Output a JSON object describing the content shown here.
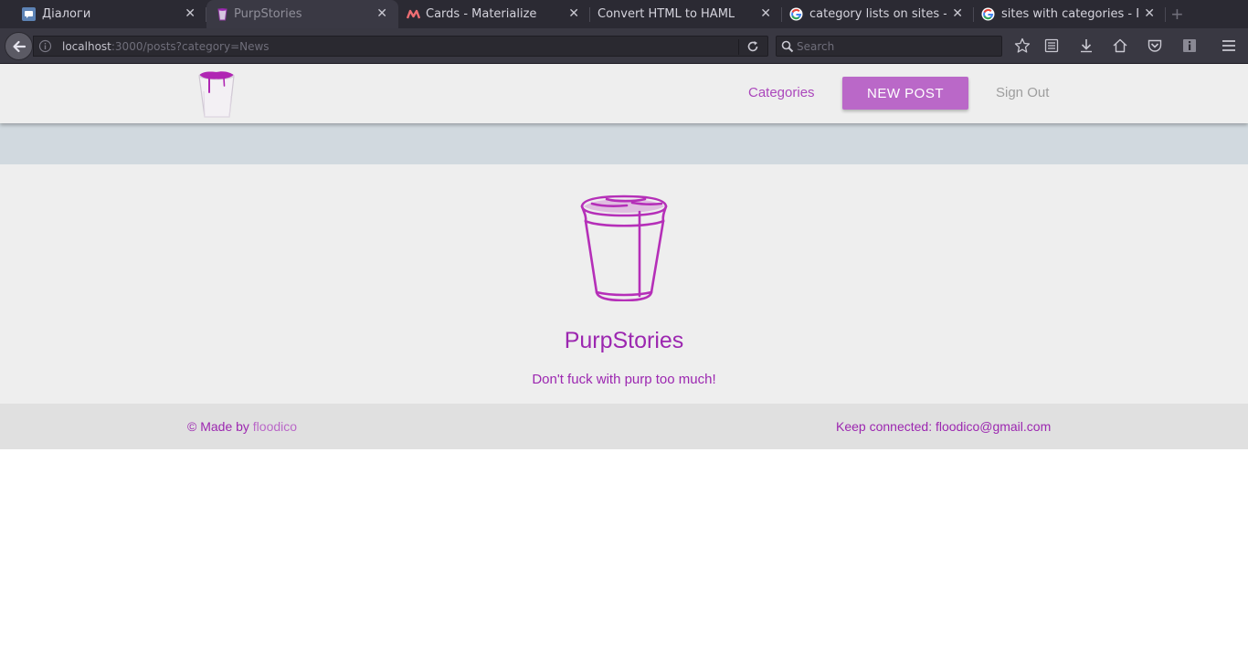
{
  "browser": {
    "tabs": [
      {
        "label": "Діалоги",
        "icon": "vk-messages-icon"
      },
      {
        "label": "PurpStories",
        "icon": "purple-cup-icon",
        "active": true
      },
      {
        "label": "Cards - Materialize",
        "icon": "materialize-icon"
      },
      {
        "label": "Convert HTML to HAML",
        "icon": ""
      },
      {
        "label": "category lists on sites - П...",
        "icon": "google-icon"
      },
      {
        "label": "sites with categories - По...",
        "icon": "google-icon"
      }
    ],
    "url_host": "localhost",
    "url_path": ":3000/posts?category=News",
    "search_placeholder": "Search"
  },
  "header": {
    "categories_label": "Categories",
    "new_post_label": "NEW POST",
    "sign_out_label": "Sign Out"
  },
  "hero": {
    "title": "PurpStories",
    "tagline": "Don't fuck with purp too much!"
  },
  "footer": {
    "made_by_prefix": "© Made by ",
    "made_by_link": "floodico",
    "contact": "Keep connected: floodico@gmail.com"
  },
  "colors": {
    "accent": "#9c27b0",
    "button": "#ba68c8",
    "header_bg": "#eeeeee",
    "subbar_bg": "#d1d9df",
    "footer_bg": "#e0e0e0"
  }
}
